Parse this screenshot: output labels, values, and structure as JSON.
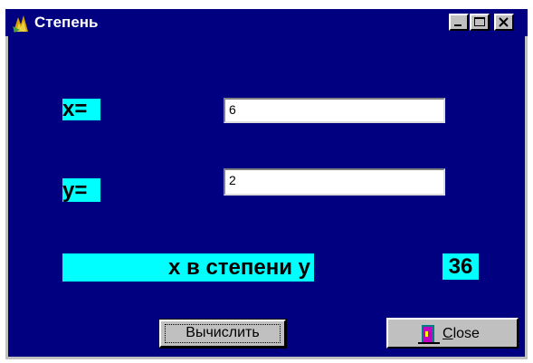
{
  "window": {
    "title": "Степень",
    "controls": [
      "minimize",
      "maximize",
      "close"
    ]
  },
  "form": {
    "x_label": "x=",
    "x_value": "6",
    "y_label": "y=",
    "y_value": "2",
    "result_label": "x в степени y",
    "result_value": "36"
  },
  "buttons": {
    "calculate_label": "Вычислить",
    "close_accel": "C",
    "close_rest": "lose"
  },
  "icons": {
    "app": "app-flame-icon",
    "close_button": "door-exit-icon"
  },
  "colors": {
    "title_bar": "#000080",
    "client_bg": "#000080",
    "label_bg": "#00ffff",
    "button_face": "#c0c0c0"
  }
}
